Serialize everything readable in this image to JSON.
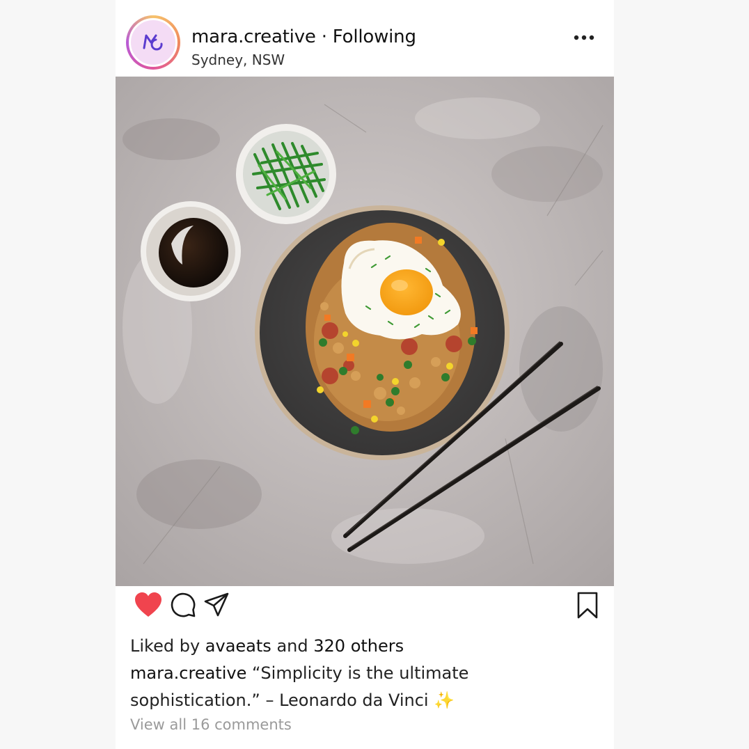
{
  "post": {
    "username": "mara.creative",
    "separator": "·",
    "follow_status": "Following",
    "location": "Sydney, NSW",
    "liked_by_prefix": "Liked by",
    "liked_by_user": "avaeats",
    "liked_by_and": "and",
    "liked_by_count": "320 others",
    "caption_user": "mara.creative",
    "caption_text": "“Simplicity is the ultimate sophistication.” – Leonardo da Vinci",
    "caption_emoji": "✨",
    "view_comments": "View all 16 comments"
  },
  "icons": {
    "avatar": "mc-monogram-icon",
    "more": "more-options-icon",
    "like": "heart-filled-icon",
    "comment": "comment-bubble-icon",
    "share": "paper-plane-icon",
    "save": "bookmark-icon"
  },
  "colors": {
    "like_red": "#f0444e",
    "avatar_purple": "#5b3ccf",
    "muted_gray": "#9a9a9a"
  }
}
